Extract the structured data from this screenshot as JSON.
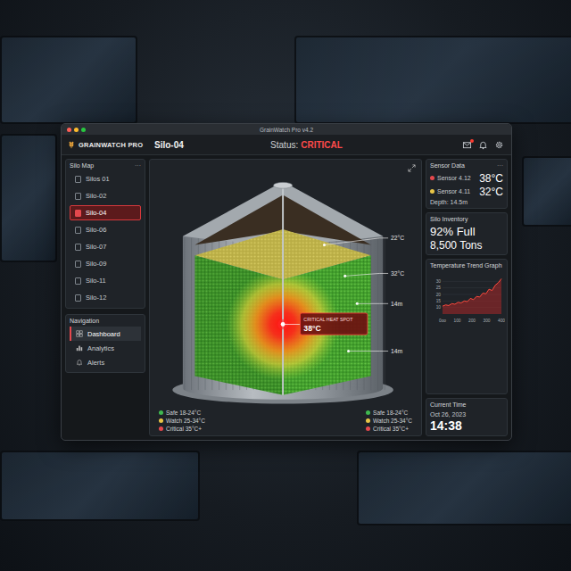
{
  "window": {
    "title": "GrainWatch Pro v4.2"
  },
  "header": {
    "brand": "GRAINWATCH PRO",
    "silo": "Silo-04",
    "status_label": "Status:",
    "status": "CRITICAL",
    "mail_badge": true
  },
  "silo_map": {
    "title": "Silo Map",
    "menu": "···",
    "items": [
      {
        "label": "Silos 01",
        "selected": false
      },
      {
        "label": "Silo-02",
        "selected": false
      },
      {
        "label": "Silo-04",
        "selected": true
      },
      {
        "label": "Silo-06",
        "selected": false
      },
      {
        "label": "Silo-07",
        "selected": false
      },
      {
        "label": "Silo-09",
        "selected": false
      },
      {
        "label": "Silo-11",
        "selected": false
      },
      {
        "label": "Silo-12",
        "selected": false
      }
    ]
  },
  "navigation": {
    "title": "Navigation",
    "items": [
      {
        "label": "Dashboard",
        "selected": true,
        "kind": "grid"
      },
      {
        "label": "Analytics",
        "selected": false,
        "kind": "chart"
      },
      {
        "label": "Alerts",
        "selected": false,
        "kind": "bell"
      }
    ]
  },
  "silo_view": {
    "labels": [
      "22°C",
      "32°C",
      "14m",
      "14m"
    ],
    "hotspot": {
      "title": "CRITICAL HEAT SPOT",
      "value": "38°C"
    },
    "legends": [
      [
        {
          "label": "Safe 18-24°C",
          "color": "#3fb950"
        },
        {
          "label": "Watch 25-34°C",
          "color": "#e8c547"
        },
        {
          "label": "Critical 35°C+",
          "color": "#e5484d"
        }
      ],
      [
        {
          "label": "Safe 18-24°C",
          "color": "#3fb950"
        },
        {
          "label": "Watch 25-34°C",
          "color": "#e8c547"
        },
        {
          "label": "Critical 35°C+",
          "color": "#e5484d"
        }
      ]
    ]
  },
  "sensor_data": {
    "title": "Sensor Data",
    "menu": "···",
    "sensors": [
      {
        "name": "Sensor 4.12",
        "value": "38°C",
        "color": "#e5484d"
      },
      {
        "name": "Sensor 4.11",
        "value": "32°C",
        "color": "#e8c547"
      }
    ],
    "depth": "Depth: 14.5m"
  },
  "inventory": {
    "title": "Silo Inventory",
    "fill": "92% Full",
    "tons": "8,500 Tons"
  },
  "trend": {
    "title": "Temperature Trend Graph",
    "y_ticks": [
      "30",
      "25",
      "20",
      "15",
      "10"
    ],
    "x_ticks": [
      "0oo",
      "100",
      "200",
      "300",
      "400"
    ],
    "values": [
      11,
      12,
      11.5,
      13,
      12.5,
      14,
      13.5,
      15,
      14.5,
      17,
      16,
      18.5,
      18,
      21,
      20.5,
      24,
      23,
      27,
      29,
      32
    ]
  },
  "clock": {
    "title": "Current Time",
    "date": "Oct 26, 2023",
    "time": "14:38"
  }
}
